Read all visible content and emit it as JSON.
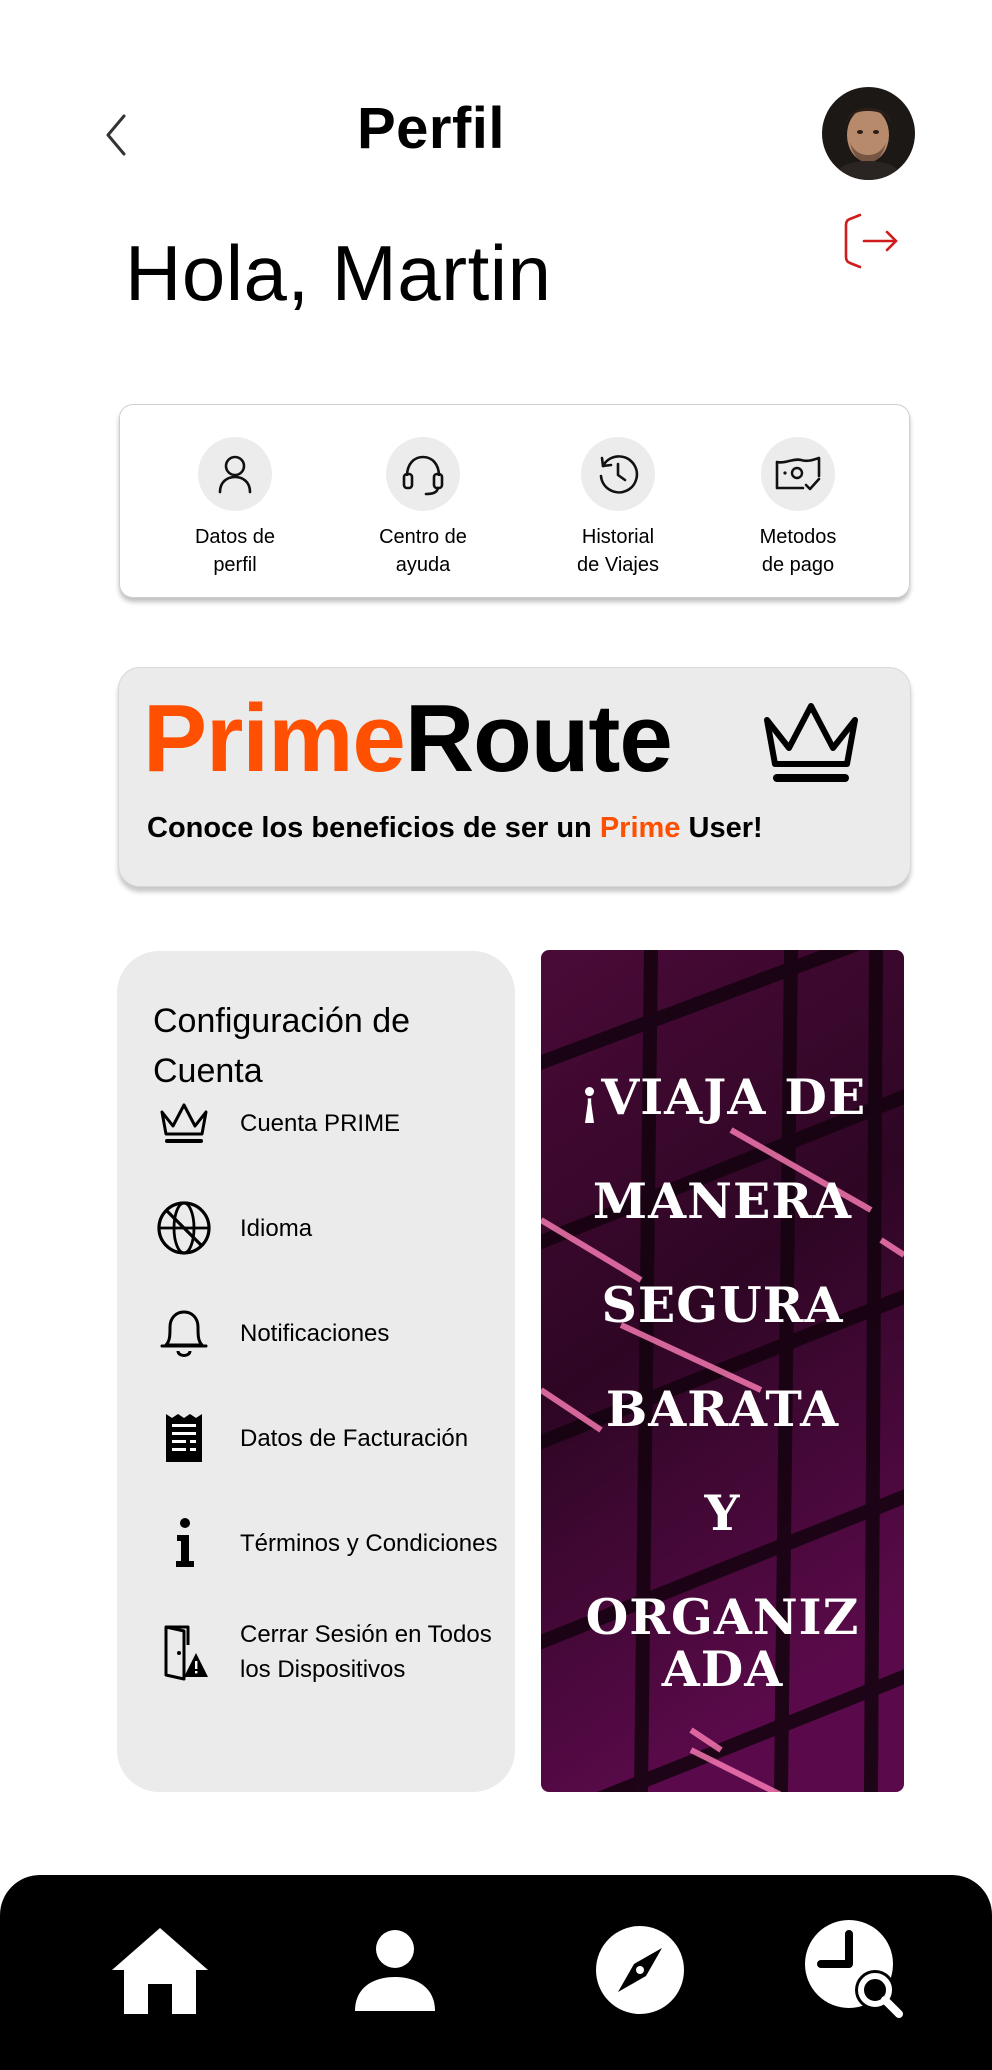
{
  "header": {
    "title": "Perfil",
    "greeting": "Hola, Martin"
  },
  "quick_actions": [
    {
      "label": "Datos de\nperfil",
      "icon": "user-icon"
    },
    {
      "label": "Centro de\nayuda",
      "icon": "headset-icon"
    },
    {
      "label": "Historial\nde Viajes",
      "icon": "history-icon"
    },
    {
      "label": "Metodos\nde pago",
      "icon": "payment-icon"
    }
  ],
  "prime": {
    "brand_part1": "Prime",
    "brand_part2": "Route",
    "tagline_before": "Conoce los beneficios de ser un ",
    "tagline_highlight": "Prime",
    "tagline_after": " User!",
    "accent_color": "#ff4f00"
  },
  "settings": {
    "title": "Configuración de Cuenta",
    "items": [
      {
        "label": "Cuenta PRIME",
        "icon": "crown-icon"
      },
      {
        "label": "Idioma",
        "icon": "language-icon"
      },
      {
        "label": "Notificaciones",
        "icon": "bell-icon"
      },
      {
        "label": "Datos de Facturación",
        "icon": "receipt-icon"
      },
      {
        "label": "Términos y Condiciones",
        "icon": "info-icon"
      },
      {
        "label": "Cerrar Sesión en Todos los Dispositivos",
        "icon": "door-warning-icon"
      }
    ]
  },
  "promo": {
    "lines": [
      "¡VIAJA DE",
      "MANERA",
      "SEGURA",
      "BARATA",
      "Y",
      "ORGANIZ",
      "ADA"
    ]
  },
  "bottom_nav": [
    {
      "icon": "home-icon"
    },
    {
      "icon": "profile-icon"
    },
    {
      "icon": "compass-icon"
    },
    {
      "icon": "clock-search-icon"
    }
  ]
}
